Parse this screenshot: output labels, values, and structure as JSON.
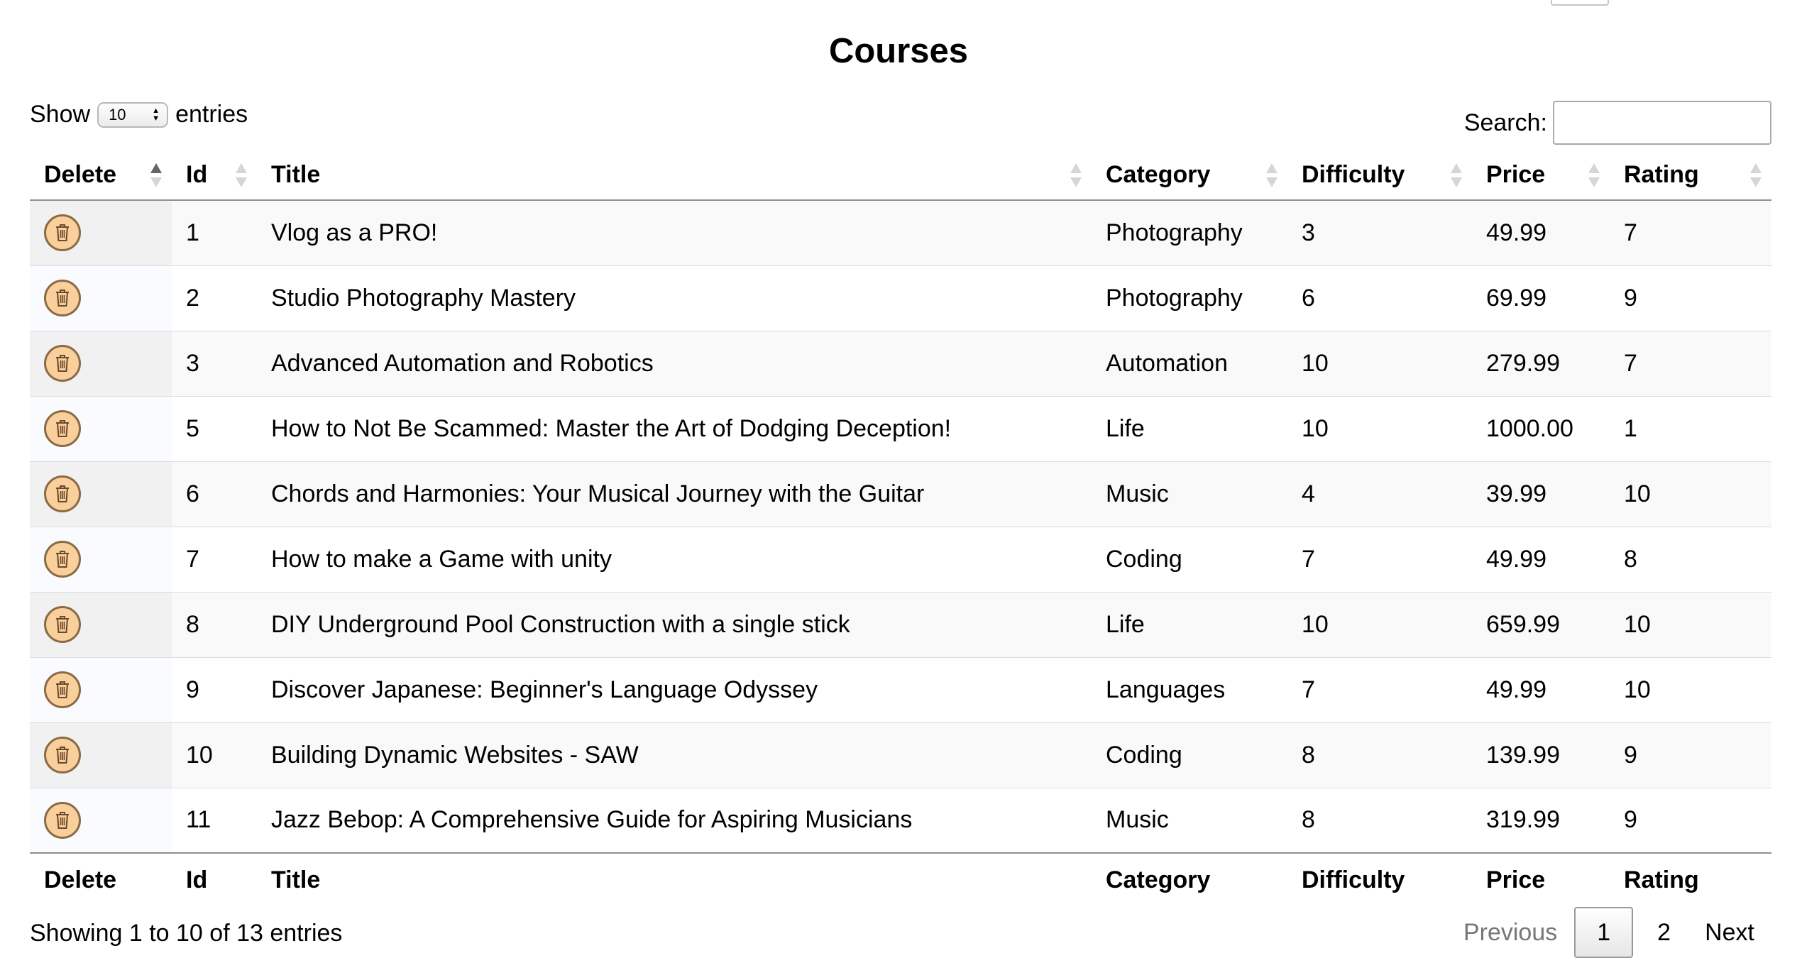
{
  "page": {
    "title": "Courses"
  },
  "length": {
    "prefix": "Show",
    "value": "10",
    "suffix": "entries"
  },
  "search": {
    "label": "Search:",
    "value": "",
    "placeholder": ""
  },
  "table": {
    "columns": [
      "Delete",
      "Id",
      "Title",
      "Category",
      "Difficulty",
      "Price",
      "Rating"
    ],
    "sorted_column": "Delete",
    "sort_direction": "asc",
    "rows": [
      {
        "id": "1",
        "title": "Vlog as a PRO!",
        "category": "Photography",
        "difficulty": "3",
        "price": "49.99",
        "rating": "7"
      },
      {
        "id": "2",
        "title": "Studio Photography Mastery",
        "category": "Photography",
        "difficulty": "6",
        "price": "69.99",
        "rating": "9"
      },
      {
        "id": "3",
        "title": "Advanced Automation and Robotics",
        "category": "Automation",
        "difficulty": "10",
        "price": "279.99",
        "rating": "7"
      },
      {
        "id": "5",
        "title": "How to Not Be Scammed: Master the Art of Dodging Deception!",
        "category": "Life",
        "difficulty": "10",
        "price": "1000.00",
        "rating": "1"
      },
      {
        "id": "6",
        "title": "Chords and Harmonies: Your Musical Journey with the Guitar",
        "category": "Music",
        "difficulty": "4",
        "price": "39.99",
        "rating": "10"
      },
      {
        "id": "7",
        "title": "How to make a Game with unity",
        "category": "Coding",
        "difficulty": "7",
        "price": "49.99",
        "rating": "8"
      },
      {
        "id": "8",
        "title": "DIY Underground Pool Construction with a single stick",
        "category": "Life",
        "difficulty": "10",
        "price": "659.99",
        "rating": "10"
      },
      {
        "id": "9",
        "title": "Discover Japanese: Beginner's Language Odyssey",
        "category": "Languages",
        "difficulty": "7",
        "price": "49.99",
        "rating": "10"
      },
      {
        "id": "10",
        "title": "Building Dynamic Websites - SAW",
        "category": "Coding",
        "difficulty": "8",
        "price": "139.99",
        "rating": "9"
      },
      {
        "id": "11",
        "title": "Jazz Bebop: A Comprehensive Guide for Aspiring Musicians",
        "category": "Music",
        "difficulty": "8",
        "price": "319.99",
        "rating": "9"
      }
    ],
    "row_action_icon": "trash-icon",
    "row_action_color": "#f9cf9c"
  },
  "info": "Showing 1 to 10 of 13 entries",
  "pagination": {
    "previous": "Previous",
    "pages": [
      "1",
      "2"
    ],
    "current": "1",
    "next": "Next"
  }
}
